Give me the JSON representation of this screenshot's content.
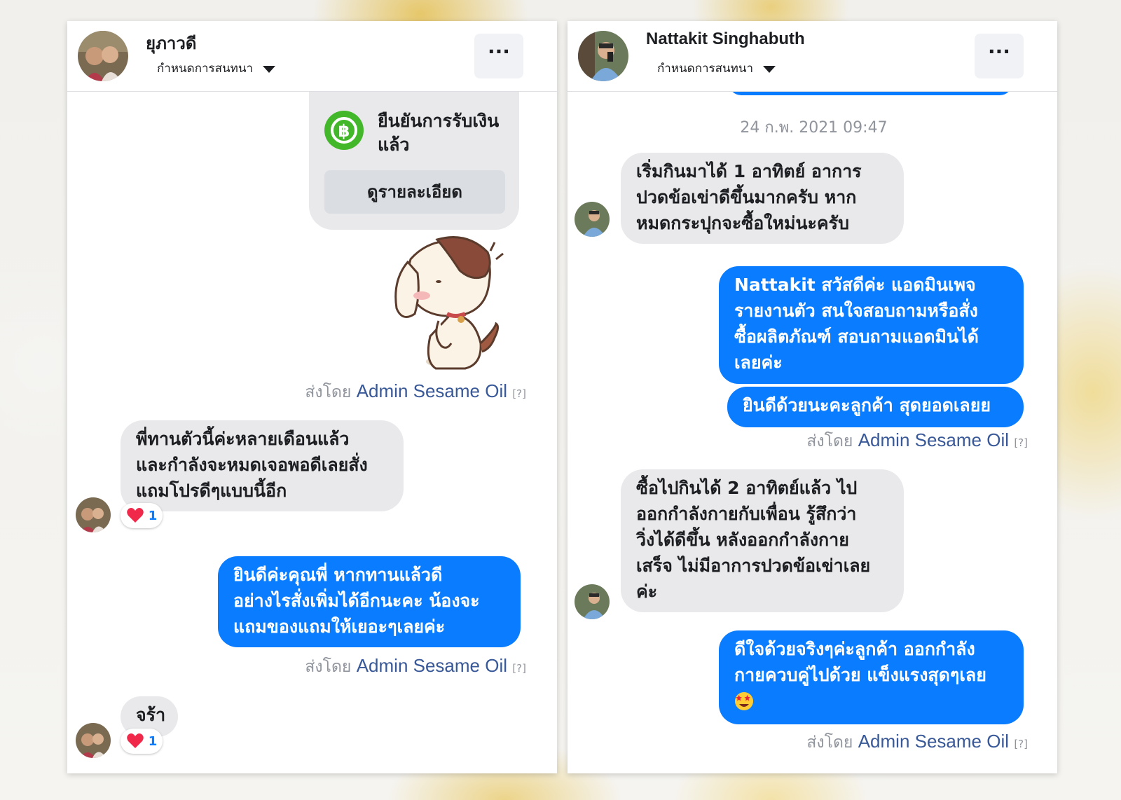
{
  "left_chat": {
    "contact_name": "ยุภาวดี",
    "subheader": "กำหนดการสนทนา",
    "menu_label": "···",
    "payment_card": {
      "title_line1": "ยืนยันการรับเงิน",
      "title_line2": "แล้ว",
      "button_label": "ดูรายละเอียด"
    },
    "sender_prefix": "ส่งโดย",
    "sender_name": "Admin Sesame Oil",
    "sender_help": "[?]",
    "messages": [
      {
        "lines": [
          "พี่ทานตัวนี้ค่ะหลายเดือนแล้ว",
          "และกำลังจะหมดเจอพอดีเลยสั่ง",
          "แถมโปรดีๆแบบนี้อีก"
        ],
        "reaction_count": "1"
      },
      {
        "lines": [
          "ยินดีค่ะคุณพี่ หากทานแล้วดี",
          "อย่างไรสั่งเพิ่มได้อีกนะคะ น้องจะ",
          "แถมของแถมให้เยอะๆเลยค่ะ"
        ]
      },
      {
        "lines": [
          "จร้า"
        ],
        "reaction_count": "1"
      }
    ]
  },
  "right_chat": {
    "contact_name": "Nattakit Singhabuth",
    "subheader": "กำหนดการสนทนา",
    "menu_label": "···",
    "timestamp": "24 ก.พ. 2021 09:47",
    "sender_prefix": "ส่งโดย",
    "sender_name": "Admin Sesame Oil",
    "sender_help": "[?]",
    "messages": [
      {
        "lines": [
          "เริ่มกินมาได้ 1 อาทิตย์ อาการ",
          "ปวดข้อเข่าดีขึ้นมากครับ หาก",
          "หมดกระปุกจะซื้อใหม่นะครับ"
        ]
      },
      {
        "lines": [
          "Nattakit สวัสดีค่ะ แอดมินเพจ",
          "รายงานตัว สนใจสอบถามหรือสั่ง",
          "ซื้อผลิตภัณฑ์ สอบถามแอดมินได้",
          "เลยค่ะ"
        ]
      },
      {
        "lines": [
          "ยินดีด้วยนะคะลูกค้า สุดยอดเลยย"
        ]
      },
      {
        "lines": [
          "ซื้อไปกินได้ 2 อาทิตย์แล้ว ไป",
          "ออกกำลังกายกับเพื่อน รู้สึกว่า",
          "วิ่งได้ดีขึ้น หลังออกกำลังกาย",
          "เสร็จ ไม่มีอาการปวดข้อเข่าเลย",
          "ค่ะ"
        ]
      },
      {
        "lines": [
          "ดีใจด้วยจริงๆค่ะลูกค้า ออกกำลัง",
          "กายควบคู่ไปด้วย แข็งแรงสุดๆเลย"
        ]
      }
    ]
  }
}
